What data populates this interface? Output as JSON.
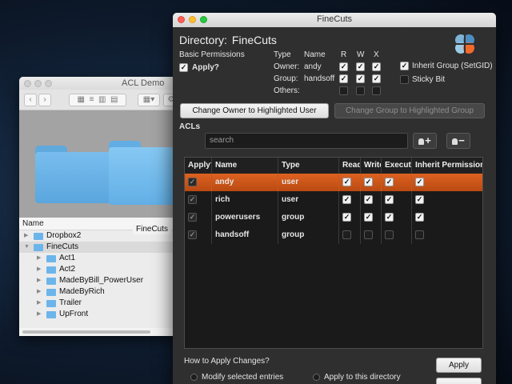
{
  "finder": {
    "title": "ACL Demo",
    "folder_label": "FineCuts",
    "list_header": "Name",
    "items": [
      {
        "name": "Dropbox2",
        "indent": 0,
        "expanded": false
      },
      {
        "name": "FineCuts",
        "indent": 0,
        "expanded": true
      },
      {
        "name": "Act1",
        "indent": 1,
        "expanded": false
      },
      {
        "name": "Act2",
        "indent": 1,
        "expanded": false
      },
      {
        "name": "MadeByBill_PowerUser",
        "indent": 1,
        "expanded": false
      },
      {
        "name": "MadeByRich",
        "indent": 1,
        "expanded": false
      },
      {
        "name": "Trailer",
        "indent": 1,
        "expanded": false
      },
      {
        "name": "UpFront",
        "indent": 1,
        "expanded": false
      }
    ]
  },
  "window": {
    "title": "FineCuts"
  },
  "directory": {
    "label": "Directory:",
    "name": "FineCuts"
  },
  "basic": {
    "label": "Basic Permissions",
    "apply_label": "Apply?",
    "apply_checked": true,
    "col_type": "Type",
    "col_name": "Name",
    "col_r": "R",
    "col_w": "W",
    "col_x": "X",
    "rows": [
      {
        "type": "Owner:",
        "name": "andy",
        "r": true,
        "w": true,
        "x": true
      },
      {
        "type": "Group:",
        "name": "handsoff",
        "r": true,
        "w": true,
        "x": true
      },
      {
        "type": "Others:",
        "name": "",
        "r": false,
        "w": false,
        "x": false
      }
    ],
    "inherit_group_label": "Inherit Group (SetGID)",
    "inherit_group_checked": true,
    "sticky_label": "Sticky Bit",
    "sticky_checked": false
  },
  "buttons": {
    "change_owner": "Change Owner to Highlighted User",
    "change_group": "Change Group to Highlighted Group",
    "apply": "Apply"
  },
  "acls": {
    "label": "ACLs",
    "search_placeholder": "search",
    "columns": [
      "Apply?",
      "Name",
      "Type",
      "Read",
      "Write",
      "Execute",
      "Inherit Permissions"
    ],
    "rows": [
      {
        "apply": true,
        "name": "andy",
        "type": "user",
        "read": true,
        "write": true,
        "execute": true,
        "inherit": true,
        "selected": true
      },
      {
        "apply": true,
        "name": "rich",
        "type": "user",
        "read": true,
        "write": true,
        "execute": true,
        "inherit": true,
        "selected": false
      },
      {
        "apply": true,
        "name": "powerusers",
        "type": "group",
        "read": true,
        "write": true,
        "execute": true,
        "inherit": true,
        "selected": false
      },
      {
        "apply": true,
        "name": "handsoff",
        "type": "group",
        "read": false,
        "write": false,
        "execute": false,
        "inherit": false,
        "selected": false
      }
    ]
  },
  "apply_changes": {
    "label": "How to Apply Changes?",
    "option1": "Modify selected entries",
    "option2": "Apply to this directory"
  },
  "colors": {
    "accent": "#c9531a",
    "folder": "#6cb5ea"
  }
}
